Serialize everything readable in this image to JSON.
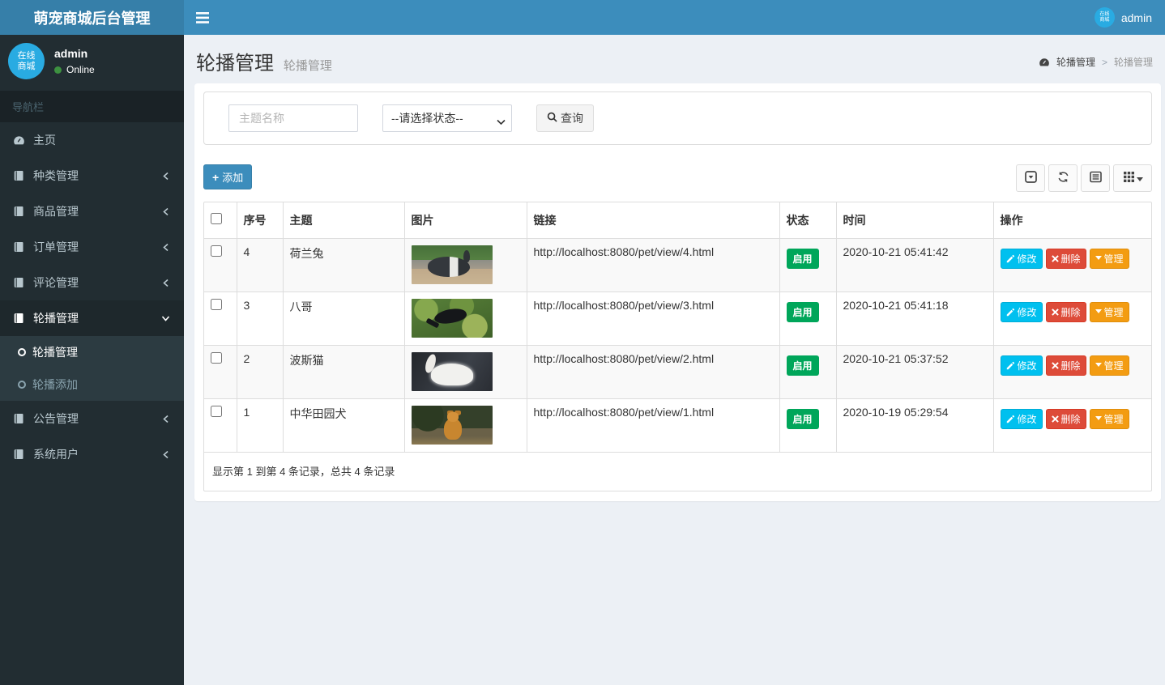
{
  "app": {
    "title": "萌宠商城后台管理",
    "user_name": "admin",
    "user_status": "Online",
    "avatar_line1": "在线",
    "avatar_line2": "商城"
  },
  "sidebar": {
    "section_label": "导航栏",
    "items": [
      {
        "label": "主页",
        "icon": "dashboard-icon",
        "expandable": false
      },
      {
        "label": "种类管理",
        "icon": "book-icon",
        "expandable": true
      },
      {
        "label": "商品管理",
        "icon": "book-icon",
        "expandable": true
      },
      {
        "label": "订单管理",
        "icon": "book-icon",
        "expandable": true
      },
      {
        "label": "评论管理",
        "icon": "book-icon",
        "expandable": true
      },
      {
        "label": "轮播管理",
        "icon": "book-icon",
        "expandable": true,
        "expanded": true,
        "active": true
      },
      {
        "label": "公告管理",
        "icon": "book-icon",
        "expandable": true
      },
      {
        "label": "系统用户",
        "icon": "book-icon",
        "expandable": true
      }
    ],
    "submenu": [
      {
        "label": "轮播管理",
        "active": true
      },
      {
        "label": "轮播添加",
        "active": false
      }
    ]
  },
  "page": {
    "title": "轮播管理",
    "subtitle": "轮播管理",
    "breadcrumb": {
      "home": "轮播管理",
      "separator": ">",
      "current": "轮播管理"
    }
  },
  "search": {
    "name_placeholder": "主题名称",
    "status_selected": "--请选择状态--",
    "query_label": "查询"
  },
  "toolbar": {
    "add_label": "添加",
    "icons": [
      "caret-square-down-icon",
      "refresh-icon",
      "detail-view-icon",
      "columns-grid-icon"
    ]
  },
  "table": {
    "columns": {
      "id": "序号",
      "theme": "主题",
      "image": "图片",
      "link": "链接",
      "status": "状态",
      "time": "时间",
      "ops": "操作"
    },
    "actions": {
      "edit": "修改",
      "delete": "删除",
      "manage": "管理"
    },
    "rows": [
      {
        "id": "4",
        "theme": "荷兰兔",
        "image_kind": "rabbit",
        "link": "http://localhost:8080/pet/view/4.html",
        "status": "启用",
        "time": "2020-10-21 05:41:42"
      },
      {
        "id": "3",
        "theme": "八哥",
        "image_kind": "bird",
        "link": "http://localhost:8080/pet/view/3.html",
        "status": "启用",
        "time": "2020-10-21 05:41:18"
      },
      {
        "id": "2",
        "theme": "波斯猫",
        "image_kind": "cat",
        "link": "http://localhost:8080/pet/view/2.html",
        "status": "启用",
        "time": "2020-10-21 05:37:52"
      },
      {
        "id": "1",
        "theme": "中华田园犬",
        "image_kind": "dog",
        "link": "http://localhost:8080/pet/view/1.html",
        "status": "启用",
        "time": "2020-10-19 05:29:54"
      }
    ],
    "summary": "显示第 1 到第 4 条记录，总共 4 条记录"
  },
  "colors": {
    "navbar": "#3c8dbc",
    "logo_bg": "#367fa9",
    "sidebar_bg": "#222d32",
    "content_bg": "#ecf0f5",
    "status_on": "#00a65a",
    "btn_edit": "#00c0ef",
    "btn_delete": "#dd4b39",
    "btn_manage": "#f39c12",
    "avatar_bg": "#29abe2",
    "online_dot": "#3d9140",
    "stripe": "#f9f9f9"
  }
}
